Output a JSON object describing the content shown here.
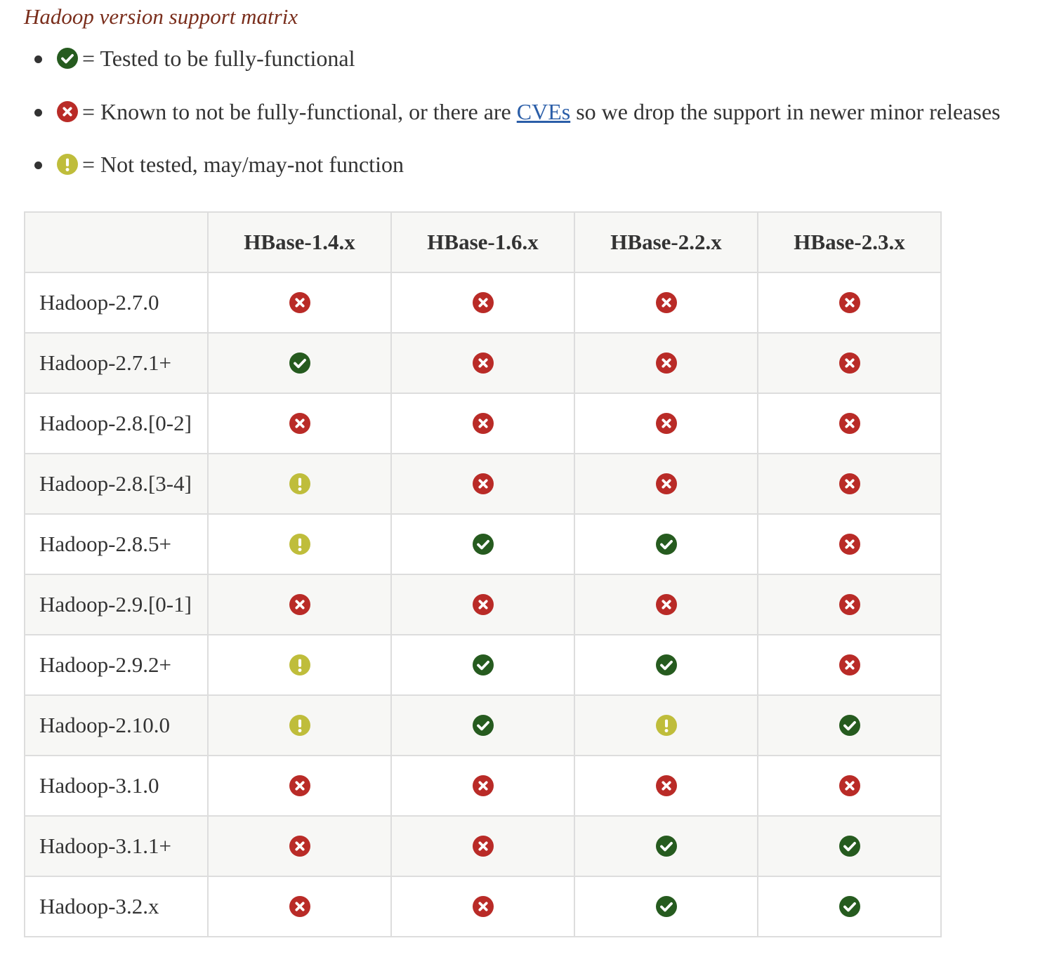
{
  "caption": "Hadoop version support matrix",
  "legend": [
    {
      "icon": "check-circle-icon",
      "text": "= Tested to be fully-functional"
    },
    {
      "icon": "x-circle-icon",
      "text_before": "= Known to not be fully-functional, or there are ",
      "link": "CVEs",
      "text_after": " so we drop the support in newer minor releases"
    },
    {
      "icon": "exclamation-circle-icon",
      "text": "= Not tested, may/may-not function"
    }
  ],
  "colors": {
    "check": "#265b1f",
    "x": "#b92b27",
    "warn": "#bfbd3b",
    "caption": "#7a2e1c",
    "link": "#2b5ea8"
  },
  "table": {
    "columns": [
      "HBase-1.4.x",
      "HBase-1.6.x",
      "HBase-2.2.x",
      "HBase-2.3.x"
    ],
    "rows": [
      {
        "label": "Hadoop-2.7.0",
        "cells": [
          "x",
          "x",
          "x",
          "x"
        ]
      },
      {
        "label": "Hadoop-2.7.1+",
        "cells": [
          "check",
          "x",
          "x",
          "x"
        ]
      },
      {
        "label": "Hadoop-2.8.[0-2]",
        "cells": [
          "x",
          "x",
          "x",
          "x"
        ]
      },
      {
        "label": "Hadoop-2.8.[3-4]",
        "cells": [
          "warn",
          "x",
          "x",
          "x"
        ]
      },
      {
        "label": "Hadoop-2.8.5+",
        "cells": [
          "warn",
          "check",
          "check",
          "x"
        ]
      },
      {
        "label": "Hadoop-2.9.[0-1]",
        "cells": [
          "x",
          "x",
          "x",
          "x"
        ]
      },
      {
        "label": "Hadoop-2.9.2+",
        "cells": [
          "warn",
          "check",
          "check",
          "x"
        ]
      },
      {
        "label": "Hadoop-2.10.0",
        "cells": [
          "warn",
          "check",
          "warn",
          "check"
        ]
      },
      {
        "label": "Hadoop-3.1.0",
        "cells": [
          "x",
          "x",
          "x",
          "x"
        ]
      },
      {
        "label": "Hadoop-3.1.1+",
        "cells": [
          "x",
          "x",
          "check",
          "check"
        ]
      },
      {
        "label": "Hadoop-3.2.x",
        "cells": [
          "x",
          "x",
          "check",
          "check"
        ]
      }
    ]
  }
}
